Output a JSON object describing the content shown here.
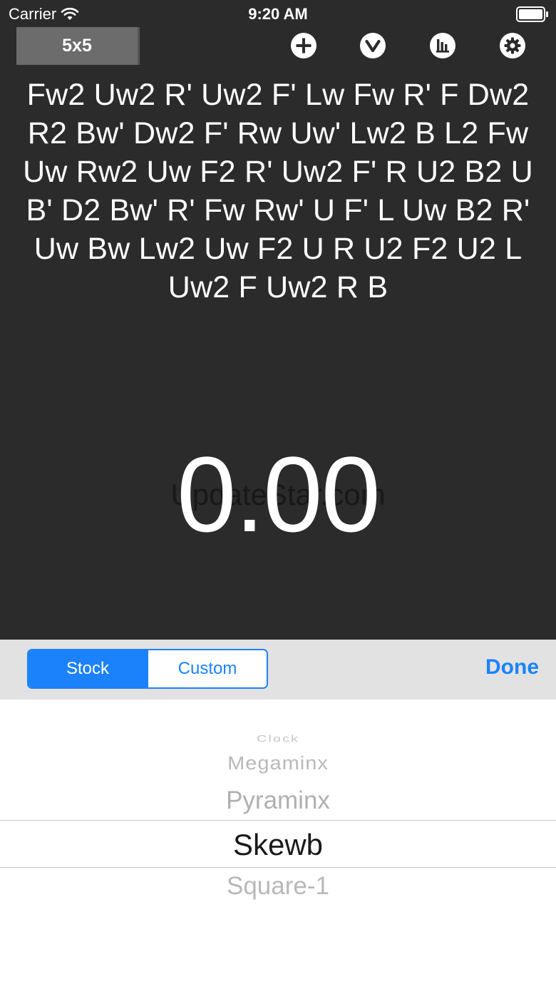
{
  "status_bar": {
    "carrier": "Carrier",
    "time": "9:20 AM",
    "icons": [
      "wifi-icon",
      "battery-icon"
    ]
  },
  "toolbar": {
    "puzzle_label": "5x5",
    "icons": [
      "plus-circle-icon",
      "chevron-down-circle-icon",
      "stats-chart-icon",
      "gear-icon"
    ]
  },
  "scramble": {
    "text": "Fw2 Uw2 R' Uw2 F' Lw Fw R' F Dw2 R2 Bw' Dw2 F' Rw Uw' Lw2 B L2 Fw Uw Rw2 Uw F2 R' Uw2 F' R U2 B2 U B' D2 Bw' R' Fw Rw' U F' L Uw B2 R' Uw Bw Lw2 Uw F2 U R U2 F2 U2 L Uw2 F Uw2 R B"
  },
  "timer": {
    "value": "0.00",
    "watermark": "UpdateStar.com"
  },
  "picker_toolbar": {
    "segments": [
      "Stock",
      "Custom"
    ],
    "selected_segment": "Stock",
    "done_label": "Done"
  },
  "picker": {
    "items": [
      "Clock",
      "Megaminx",
      "Pyraminx",
      "Skewb",
      "Square-1"
    ],
    "selected": "Skewb"
  },
  "colors": {
    "background": "#2b2b2c",
    "accent": "#1b82fb",
    "text_light": "#ffffff"
  }
}
